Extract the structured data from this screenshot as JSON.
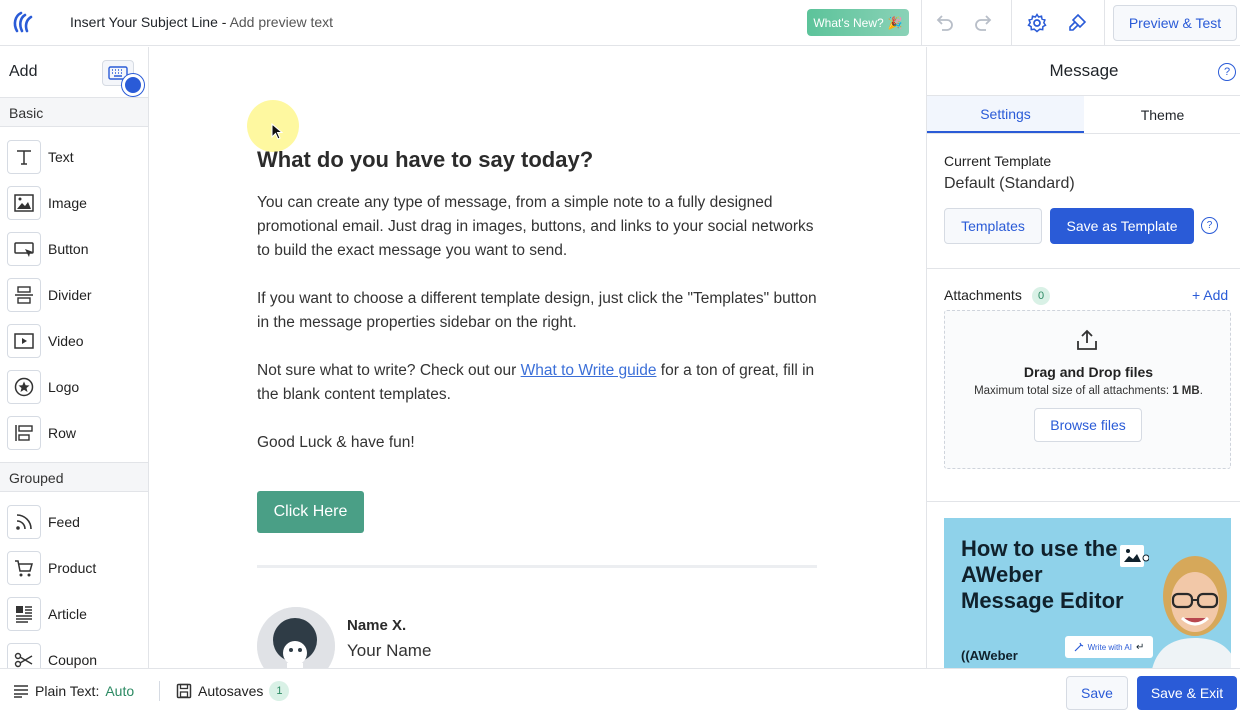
{
  "header": {
    "subject": "Insert Your Subject Line",
    "separator": " - ",
    "preview_text": "Add preview text",
    "whats_new": "What's New?",
    "whats_new_emoji": "🎉",
    "preview_test": "Preview & Test"
  },
  "sidebar": {
    "title": "Add",
    "basic_label": "Basic",
    "basic_items": [
      {
        "label": "Text",
        "icon": "text-icon"
      },
      {
        "label": "Image",
        "icon": "image-icon"
      },
      {
        "label": "Button",
        "icon": "button-icon"
      },
      {
        "label": "Divider",
        "icon": "divider-icon"
      },
      {
        "label": "Video",
        "icon": "video-icon"
      },
      {
        "label": "Logo",
        "icon": "logo-icon"
      },
      {
        "label": "Row",
        "icon": "row-icon"
      }
    ],
    "grouped_label": "Grouped",
    "grouped_items": [
      {
        "label": "Feed",
        "icon": "feed-icon"
      },
      {
        "label": "Product",
        "icon": "cart-icon"
      },
      {
        "label": "Article",
        "icon": "article-icon"
      },
      {
        "label": "Coupon",
        "icon": "scissors-icon"
      }
    ]
  },
  "canvas": {
    "heading": "What do you have to say today?",
    "p1": "You can create any type of message, from a simple note to a fully designed promotional email. Just drag in images, buttons, and links to your social networks to build the exact message you want to send.",
    "p2": "If you want to choose a different template design, just click the \"Templates\" button in the message properties sidebar on the right.",
    "p3_before": "Not sure what to write? Check out our ",
    "p3_link": "What to Write guide",
    "p3_after": " for a ton of great, fill in the blank content templates.",
    "p4": "Good Luck & have fun!",
    "cta": "Click Here",
    "sig_name": "Name X.",
    "sig_sub": "Your Name"
  },
  "panel": {
    "title": "Message",
    "help": "?",
    "tabs": [
      "Settings",
      "Theme"
    ],
    "current_template_label": "Current Template",
    "current_template_value": "Default (Standard)",
    "templates_btn": "Templates",
    "save_template_btn": "Save as Template",
    "attachments_label": "Attachments",
    "attachments_count": "0",
    "add_link": "+ Add",
    "dz_title": "Drag and Drop files",
    "dz_sub_before": "Maximum total size of all attachments: ",
    "dz_sub_bold": "1 MB",
    "dz_sub_after": ".",
    "browse_btn": "Browse files",
    "promo_title": "How to use the AWeber Message Editor",
    "promo_brand": "AWeber",
    "promo_chip": "Write with AI"
  },
  "footer": {
    "plain_text_label": "Plain Text:",
    "plain_text_value": "Auto",
    "autosaves_label": "Autosaves",
    "autosaves_count": "1",
    "save": "Save",
    "save_exit": "Save & Exit"
  },
  "colors": {
    "primary": "#2a5bd7",
    "cta_green": "#4a9f86",
    "accent_green": "#2c8a63"
  }
}
